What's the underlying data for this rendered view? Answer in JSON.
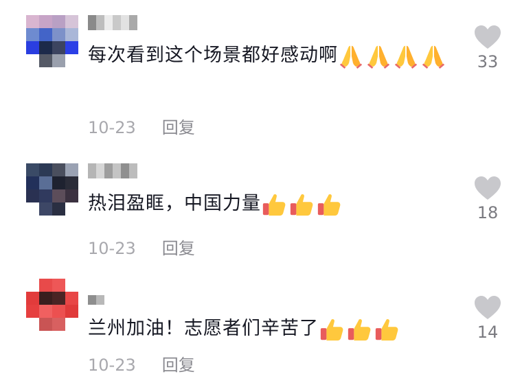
{
  "comments": [
    {
      "text": "每次看到这个场景都好感动啊",
      "emoji": [
        "praying-hands",
        "praying-hands",
        "praying-hands",
        "praying-hands"
      ],
      "date": "10-23",
      "reply_label": "回复",
      "likes": "33"
    },
    {
      "text": "热泪盈眶，中国力量",
      "emoji": [
        "thumbs-up",
        "thumbs-up",
        "thumbs-up"
      ],
      "date": "10-23",
      "reply_label": "回复",
      "likes": "18"
    },
    {
      "text": "兰州加油！志愿者们辛苦了",
      "emoji": [
        "thumbs-up",
        "thumbs-up",
        "thumbs-up"
      ],
      "date": "10-23",
      "reply_label": "回复",
      "likes": "14"
    }
  ],
  "colors": {
    "text": "#161823",
    "meta": "#a8a8ad",
    "heart": "#c8c8cc"
  }
}
